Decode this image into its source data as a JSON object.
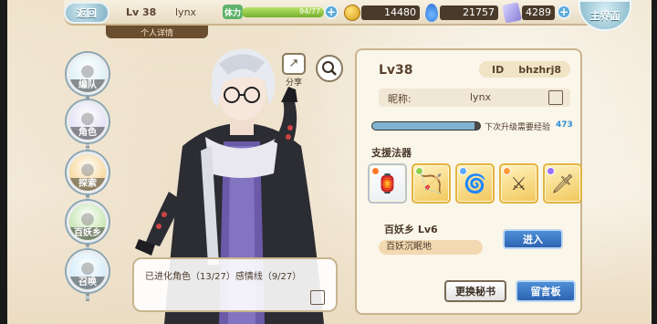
{
  "topbar": {
    "back_label": "返回",
    "level": "Lv 38",
    "name": "lynx",
    "profile_tab": "个人详情",
    "stamina_label": "体力",
    "stamina_text": "94/77",
    "stamina_ratio": 1.0,
    "gold": "14480",
    "gems": "21757",
    "tickets": "4289",
    "main_label": "主界面"
  },
  "nav": [
    {
      "label": "编队",
      "icon": "team-icon",
      "color": "#cde9f0"
    },
    {
      "label": "角色",
      "icon": "character-icon",
      "color": "#d8d0f0"
    },
    {
      "label": "探索",
      "icon": "explore-icon",
      "color": "#f3c56a"
    },
    {
      "label": "百妖乡",
      "icon": "village-icon",
      "color": "#a9d98b"
    },
    {
      "label": "召唤",
      "icon": "summon-icon",
      "color": "#bfe3f6"
    }
  ],
  "character": {
    "share_label": "分享",
    "dialogue": "已进化角色（13/27）感情线（9/27）"
  },
  "panel": {
    "level": "Lv38",
    "id_label": "ID",
    "id_value": "bhzhrj8",
    "nickname_label": "昵称:",
    "nickname_value": "lynx",
    "exp_label": "下次升级需要经验",
    "exp_value": "473",
    "exp_ratio": 0.95,
    "support_title": "支援法器",
    "artifacts": [
      {
        "icon": "red-lantern-icon",
        "glyph": "🏮",
        "badge": "#ff7a2a",
        "selected": true
      },
      {
        "icon": "crossbow-icon",
        "glyph": "🏹",
        "badge": "#8fd14f",
        "selected": false
      },
      {
        "icon": "blue-flower-icon",
        "glyph": "🌀",
        "badge": "#5aa9ff",
        "selected": false
      },
      {
        "icon": "golden-sword-icon",
        "glyph": "⚔",
        "badge": "#ff9a3a",
        "selected": false
      },
      {
        "icon": "dark-blade-icon",
        "glyph": "🗡",
        "badge": "#9a6fff",
        "selected": false
      }
    ],
    "domain_name": "百妖乡  Lv6",
    "domain_sub": "百妖沉眠地",
    "enter_label": "进入",
    "secretary_label": "更换秘书",
    "message_label": "留言板"
  }
}
